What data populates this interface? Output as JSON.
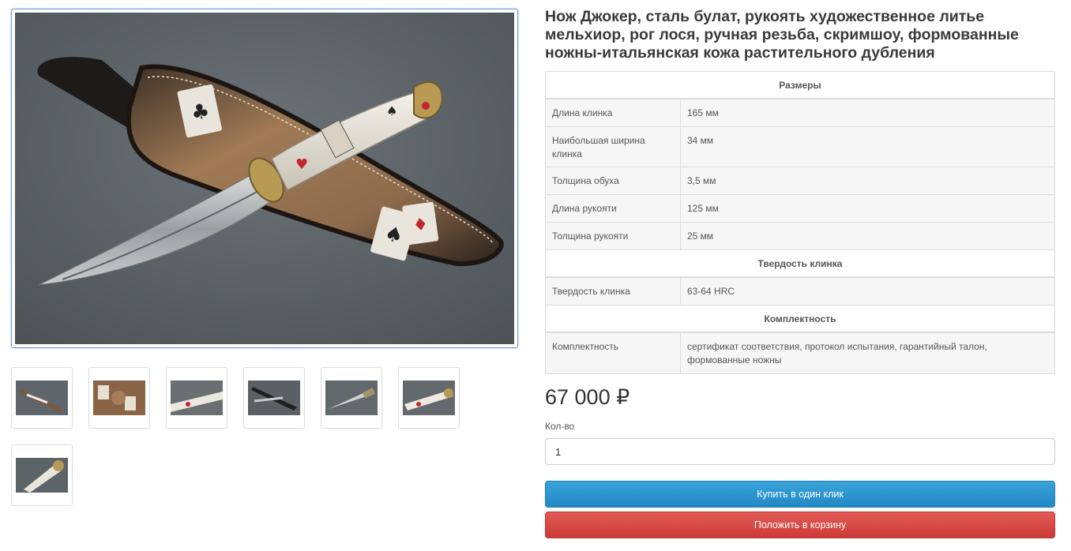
{
  "product": {
    "title": "Нож Джокер, сталь булат, рукоять художественное литье мельхиор, рог лося, ручная резьба, скримшоу, формованные ножны-итальянская кожа растительного дубления",
    "price": "67 000 ₽",
    "qty_label": "Кол-во",
    "qty_value": "1",
    "buy_one_click_label": "Купить в один клик",
    "add_to_cart_label": "Положить в корзину"
  },
  "gallery": {
    "thumbnails": [
      {
        "icon": "knife-in-sheath-thumbnail"
      },
      {
        "icon": "sheath-closeup-thumbnail"
      },
      {
        "icon": "handle-closeup-thumbnail"
      },
      {
        "icon": "knife-and-sheath-dark-thumbnail"
      },
      {
        "icon": "blade-closeup-thumbnail"
      },
      {
        "icon": "handle-detail-thumbnail"
      },
      {
        "icon": "pommel-closeup-thumbnail"
      }
    ]
  },
  "specs": {
    "section_sizes": "Размеры",
    "blade_length_label": "Длина клинка",
    "blade_length_value": "165 мм",
    "blade_width_label": "Наибольшая ширина клинка",
    "blade_width_value": "34 мм",
    "spine_thickness_label": "Толщина обуха",
    "spine_thickness_value": "3,5 мм",
    "handle_length_label": "Длина рукояти",
    "handle_length_value": "125 мм",
    "handle_thickness_label": "Толщина рукояти",
    "handle_thickness_value": "25 мм",
    "section_hardness": "Твердость клинка",
    "hardness_label": "Твердость клинка",
    "hardness_value": "63-64 HRC",
    "section_kit": "Комплектность",
    "kit_label": "Комплектность",
    "kit_value": "сертификат соответствия, протокол испытания, гарантийный талон, формованные ножны"
  },
  "colors": {
    "buy_button": "#2a95cf",
    "cart_button": "#d6463f",
    "photo_background": "#5d6469"
  }
}
